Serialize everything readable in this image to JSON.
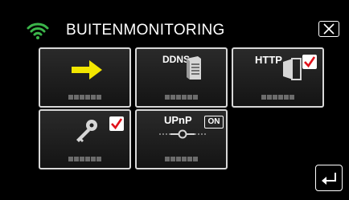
{
  "header": {
    "title": "BUITENMONITORING"
  },
  "tiles": [
    {
      "name": "forward",
      "label": "",
      "checked": false
    },
    {
      "name": "ddns",
      "label": "DDNS",
      "checked": false
    },
    {
      "name": "http",
      "label": "HTTP",
      "checked": true
    },
    {
      "name": "key",
      "label": "",
      "checked": true
    },
    {
      "name": "upnp",
      "label": "UPnP",
      "status": "ON",
      "checked": false
    }
  ],
  "colors": {
    "accent_arrow": "#f2e600",
    "check": "#e0111a",
    "wifi": "#3bb54a"
  }
}
